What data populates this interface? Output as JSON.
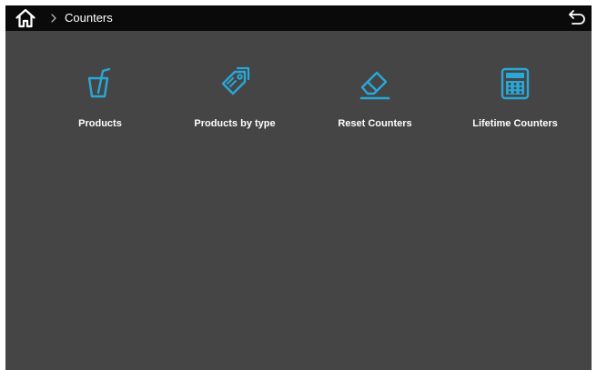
{
  "colors": {
    "topbar_bg": "#0a0a0a",
    "content_bg": "#454545",
    "accent": "#29a8d8",
    "text": "#ffffff"
  },
  "topbar": {
    "home_icon": "home-icon",
    "breadcrumb_separator": "chevron-right-icon",
    "breadcrumb_current": "Counters",
    "back_icon": "back-arrow-icon"
  },
  "menu": {
    "items": [
      {
        "label": "Products",
        "icon": "cup-straw-icon"
      },
      {
        "label": "Products by type",
        "icon": "tags-icon"
      },
      {
        "label": "Reset Counters",
        "icon": "eraser-icon"
      },
      {
        "label": "Lifetime Counters",
        "icon": "calculator-icon"
      }
    ]
  }
}
